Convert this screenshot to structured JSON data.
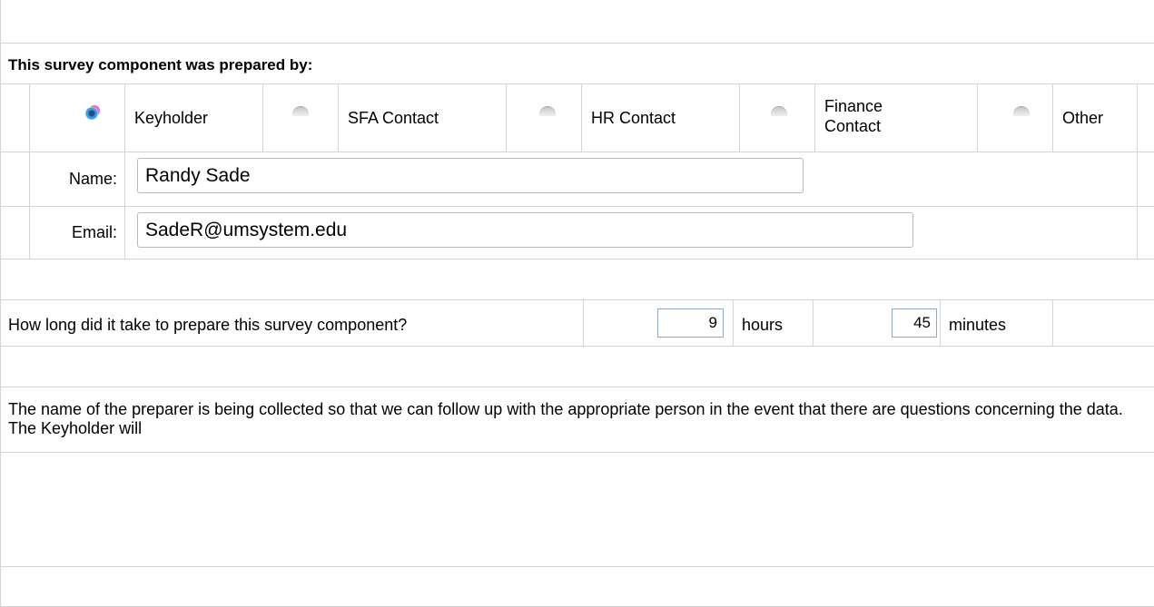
{
  "section_header": "This survey component was prepared by:",
  "preparer_roles": [
    {
      "label": "Keyholder",
      "selected": true
    },
    {
      "label": "SFA Contact",
      "selected": false
    },
    {
      "label": "HR Contact",
      "selected": false
    },
    {
      "label": "Finance Contact",
      "selected": false
    },
    {
      "label": "Other",
      "selected": false
    }
  ],
  "name_field": {
    "label": "Name:",
    "value": "Randy Sade"
  },
  "email_field": {
    "label": "Email:",
    "value": "SadeR@umsystem.edu"
  },
  "time_question": {
    "label": "How long did it take to prepare this survey component?",
    "hours_value": "9",
    "hours_unit": "hours",
    "minutes_value": "45",
    "minutes_unit": "minutes"
  },
  "note": "The name of the preparer is being collected so that we can follow up with the appropriate person in the event that there are questions concerning the data. The Keyholder will"
}
